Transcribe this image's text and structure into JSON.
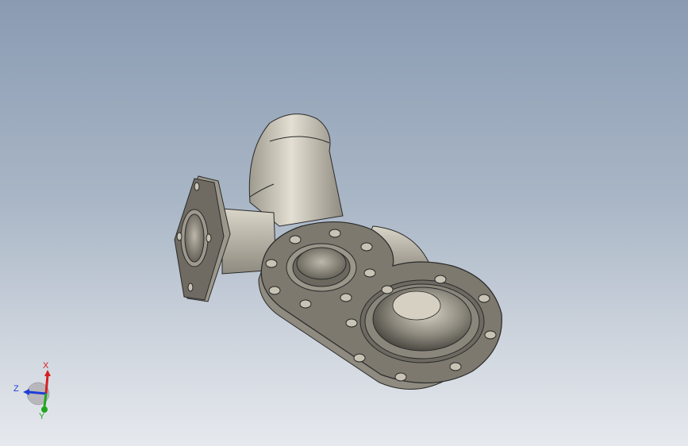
{
  "viewport": {
    "background_top": "#8a9bb2",
    "background_bottom": "#e6e9ee"
  },
  "model": {
    "part_color": "#c9c4b6",
    "face_color": "#7a766c",
    "edge_color": "#2a2a2a",
    "hole_color": "#c8c3b4"
  },
  "triad": {
    "x_label": "X",
    "y_label": "Y",
    "z_label": "Z",
    "x_color": "#d62020",
    "y_color": "#1fa51f",
    "z_color": "#1f3fd6"
  }
}
